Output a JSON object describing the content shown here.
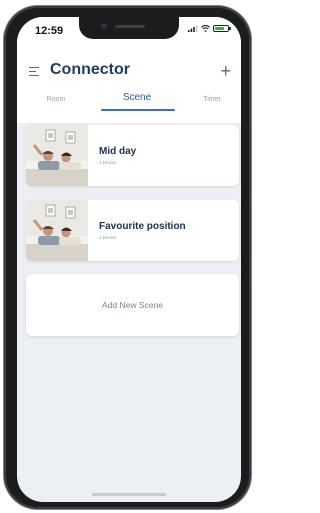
{
  "status_bar": {
    "time": "12:59",
    "battery_level": 0.75,
    "colors": {
      "battery": "#2db24a"
    }
  },
  "header": {
    "title": "Connector",
    "menu_icon": "hamburger-icon",
    "add_icon": "plus-icon",
    "add_glyph": "+"
  },
  "tabs": {
    "items": [
      {
        "label": "Room"
      },
      {
        "label": "Scene"
      },
      {
        "label": "Timer"
      }
    ],
    "active": "Scene",
    "accent": "#3b6fc4"
  },
  "scenes": [
    {
      "name": "Mid day",
      "subtitle": "1 Device"
    },
    {
      "name": "Favourite position",
      "subtitle": "1 Device"
    }
  ],
  "add_scene": {
    "label": "Add New Scene"
  }
}
